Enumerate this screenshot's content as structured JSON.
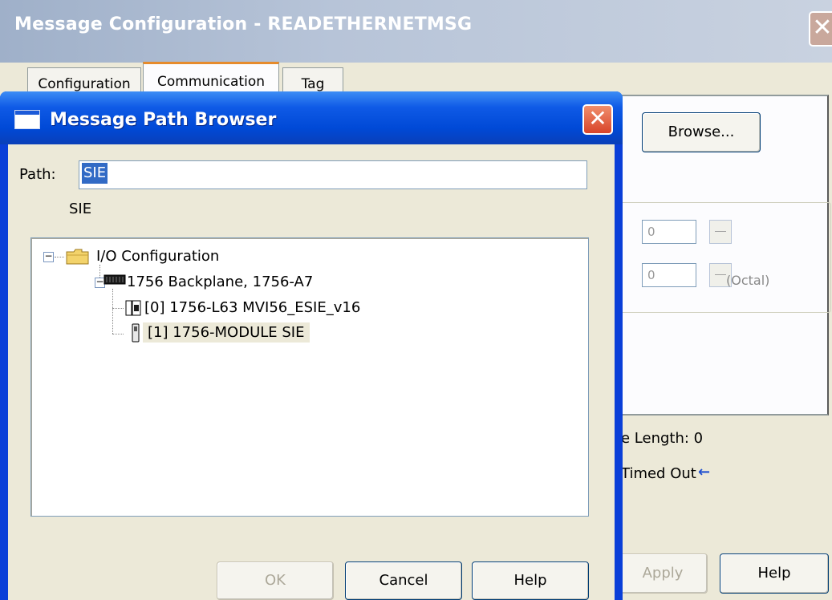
{
  "outer_dialog": {
    "title": "Message Configuration - READETHERNETMSG",
    "close_glyph": "✕",
    "tabs": [
      {
        "label": "Configuration"
      },
      {
        "label": "Communication"
      },
      {
        "label": "Tag"
      }
    ],
    "browse_label": "Browse...",
    "spin1_value": "0",
    "spin2_value": "0",
    "octal_label": "(Octal)",
    "length_text": "e Length: 0",
    "timed_out_text": "Timed Out",
    "timed_out_arrow": "←",
    "apply_label": "Apply",
    "help_label": "Help"
  },
  "path_browser": {
    "title": "Message Path Browser",
    "close_glyph": "✕",
    "path_label": "Path:",
    "path_value": "SIE",
    "resolved_path": "SIE",
    "tree": {
      "root_label": "I/O Configuration",
      "backplane_label": "1756 Backplane, 1756-A7",
      "slot0_label": "[0] 1756-L63 MVI56_ESIE_v16",
      "slot1_label": "[1] 1756-MODULE SIE"
    },
    "ok_label": "OK",
    "cancel_label": "Cancel",
    "help_label": "Help"
  },
  "colors": {
    "titlebar_active": "#0049d6",
    "titlebar_inactive": "#b7c4d8",
    "selection": "#316ac5",
    "window_bg": "#ece9d8"
  }
}
